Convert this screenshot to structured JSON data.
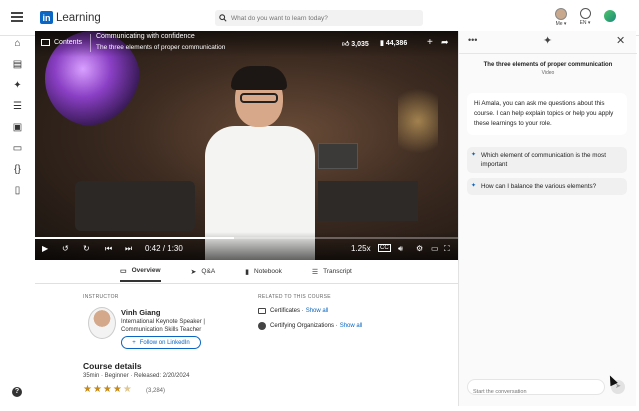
{
  "topbar": {
    "logo_text": "Learning",
    "search_placeholder": "What do you want to learn today?",
    "me_label": "Me ▾",
    "lang_label": "EN ▾"
  },
  "video": {
    "contents_label": "Contents",
    "course_title": "Communicating with confidence",
    "lesson_title": "The three elements of proper communication",
    "likes": "3,035",
    "saves": "44,386",
    "time": "0:42 / 1:30",
    "progress": 0.47,
    "speed": "1.25x",
    "cc_label": "CC"
  },
  "tabs": [
    {
      "label": "Overview",
      "icon": "overview-icon"
    },
    {
      "label": "Q&A",
      "icon": "qa-icon"
    },
    {
      "label": "Notebook",
      "icon": "notebook-icon"
    },
    {
      "label": "Transcript",
      "icon": "transcript-icon"
    }
  ],
  "instructor": {
    "heading": "INSTRUCTOR",
    "name": "Vinh Giang",
    "title": "International Keynote Speaker | Communication Skills Teacher",
    "follow_label": "Follow on LinkedIn"
  },
  "related": {
    "heading": "RELATED TO THIS COURSE",
    "certificates_label": "Certificates ·",
    "certificates_link": "Show all",
    "orgs_label": "Certifying Organizations ·",
    "orgs_link": "Show all"
  },
  "course_details": {
    "heading": "Course details",
    "meta": "35min · Beginner · Released: 2/20/2024",
    "rating": 4.5,
    "rating_count": "(3,284)"
  },
  "panel": {
    "title": "The three elements of proper communication",
    "subtitle": "Video",
    "greeting": "Hi Amala, you can ask me questions about this course. I can help explain topics or help you apply these learnings to your role.",
    "suggestions": [
      "Which element of communication is the most important",
      "How can I balance the various elements?"
    ],
    "input_placeholder": "Start the conversation"
  },
  "colors": {
    "accent": "#0a66c2",
    "star": "#c58a17"
  }
}
